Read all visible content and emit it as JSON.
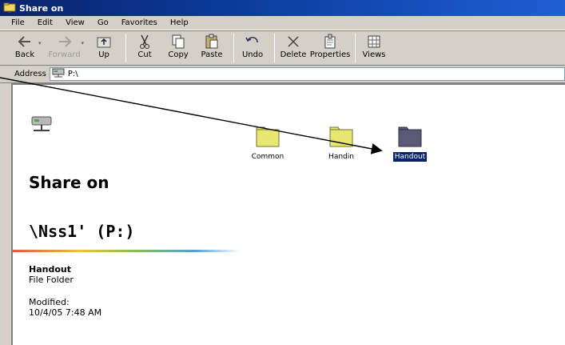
{
  "window": {
    "title": "Share on"
  },
  "menu": [
    "File",
    "Edit",
    "View",
    "Go",
    "Favorites",
    "Help"
  ],
  "toolbar": {
    "back": "Back",
    "forward": "Forward",
    "up": "Up",
    "cut": "Cut",
    "copy": "Copy",
    "paste": "Paste",
    "undo": "Undo",
    "delete": "Delete",
    "properties": "Properties",
    "views": "Views"
  },
  "address": {
    "label": "Address",
    "value": "P:\\"
  },
  "left_pane": {
    "title_line1": "Share on",
    "title_line2": "\\Nss1' (P:)",
    "selected_name": "Handout",
    "selected_type": "File Folder",
    "modified_label": "Modified:",
    "modified_date": "10/4/05 7:48 AM"
  },
  "folders": [
    {
      "label": "Common",
      "icon": "folder-icon",
      "selected": false
    },
    {
      "label": "Handin",
      "icon": "folder-icon",
      "selected": false
    },
    {
      "label": "Handout",
      "icon": "folder-icon",
      "selected": true
    }
  ],
  "colors": {
    "titlebar": "#0a246a",
    "folder_yellow": "#e8e870",
    "folder_selected": "#5a5a78",
    "selection": "#0a246a"
  }
}
